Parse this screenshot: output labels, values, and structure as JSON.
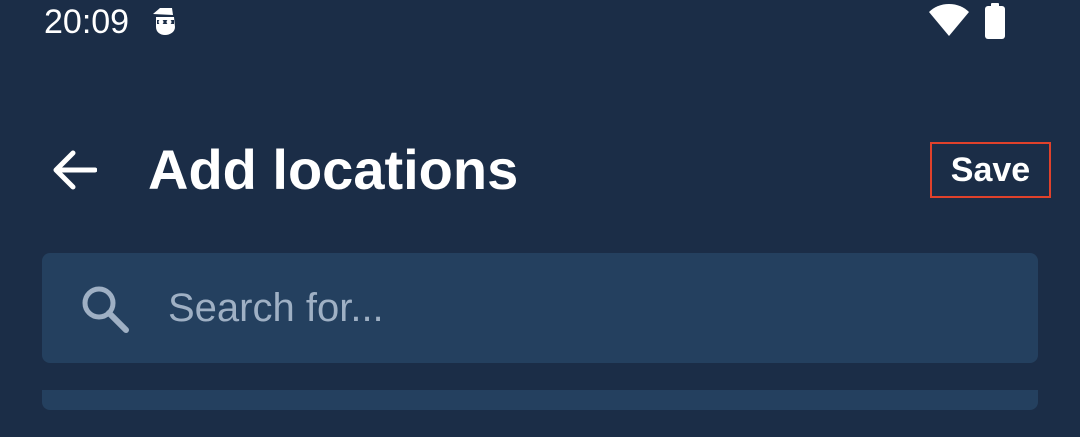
{
  "status_bar": {
    "time": "20:09",
    "icons": [
      "spy-icon",
      "wifi-icon",
      "battery-icon"
    ]
  },
  "app_bar": {
    "back_icon": "arrow-left-icon",
    "title": "Add locations",
    "save_label": "Save"
  },
  "search": {
    "icon": "search-icon",
    "placeholder": "Search for...",
    "value": ""
  },
  "colors": {
    "background": "#1b2d47",
    "surface": "#24405f",
    "text": "#ffffff",
    "placeholder": "#9fb0c4",
    "highlight_border": "#e0412b"
  }
}
